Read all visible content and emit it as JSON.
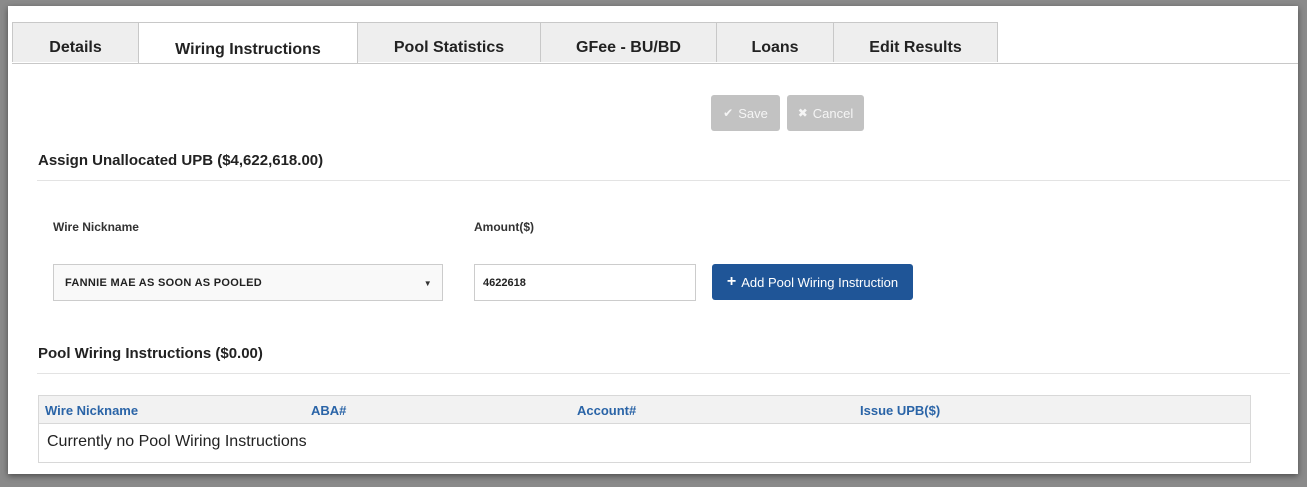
{
  "tabs": [
    {
      "label": "Details",
      "active": false
    },
    {
      "label": "Wiring Instructions",
      "active": true
    },
    {
      "label": "Pool Statistics",
      "active": false
    },
    {
      "label": "GFee - BU/BD",
      "active": false
    },
    {
      "label": "Loans",
      "active": false
    },
    {
      "label": "Edit Results",
      "active": false
    }
  ],
  "actions": {
    "save_label": "Save",
    "cancel_label": "Cancel",
    "save_icon": "check-icon",
    "cancel_icon": "x-icon"
  },
  "assign": {
    "title": "Assign Unallocated UPB ($4,622,618.00)",
    "wire_nickname_label": "Wire Nickname",
    "amount_label": "Amount($)",
    "selected_wire": "FANNIE MAE AS SOON AS POOLED",
    "amount_value": "4622618",
    "add_button_label": "Add Pool Wiring Instruction",
    "add_icon": "plus-icon"
  },
  "pool": {
    "title": "Pool Wiring Instructions ($0.00)",
    "columns": [
      "Wire Nickname",
      "ABA#",
      "Account#",
      "Issue UPB($)"
    ],
    "empty_message": "Currently no Pool Wiring Instructions"
  },
  "colors": {
    "primary": "#1f5597",
    "header_link": "#2a64a7",
    "disabled": "#c2c2c2"
  }
}
